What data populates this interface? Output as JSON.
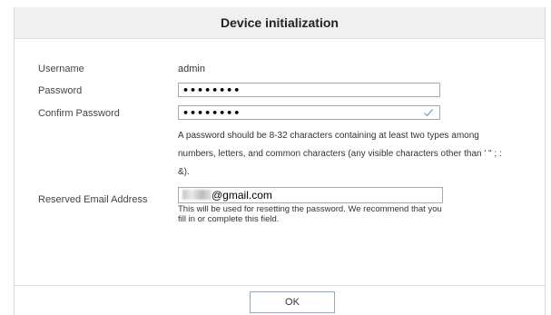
{
  "dialog": {
    "title": "Device initialization"
  },
  "form": {
    "username_label": "Username",
    "username_value": "admin",
    "password_label": "Password",
    "password_value": "••••••••",
    "confirm_label": "Confirm Password",
    "confirm_value": "••••••••",
    "password_hint_line1": "A password should be 8-32 characters containing at least two types among",
    "password_hint_line2": "numbers, letters, and common characters (any visible characters other than ' \" ; :",
    "password_hint_line3": "&).",
    "email_label": "Reserved Email Address",
    "email_value_suffix": "@gmail.com",
    "email_hint": "This will be used for resetting the password. We recommend that you fill in or complete this field."
  },
  "footer": {
    "ok_label": "OK"
  },
  "icons": {
    "confirm_valid": "check-icon"
  }
}
